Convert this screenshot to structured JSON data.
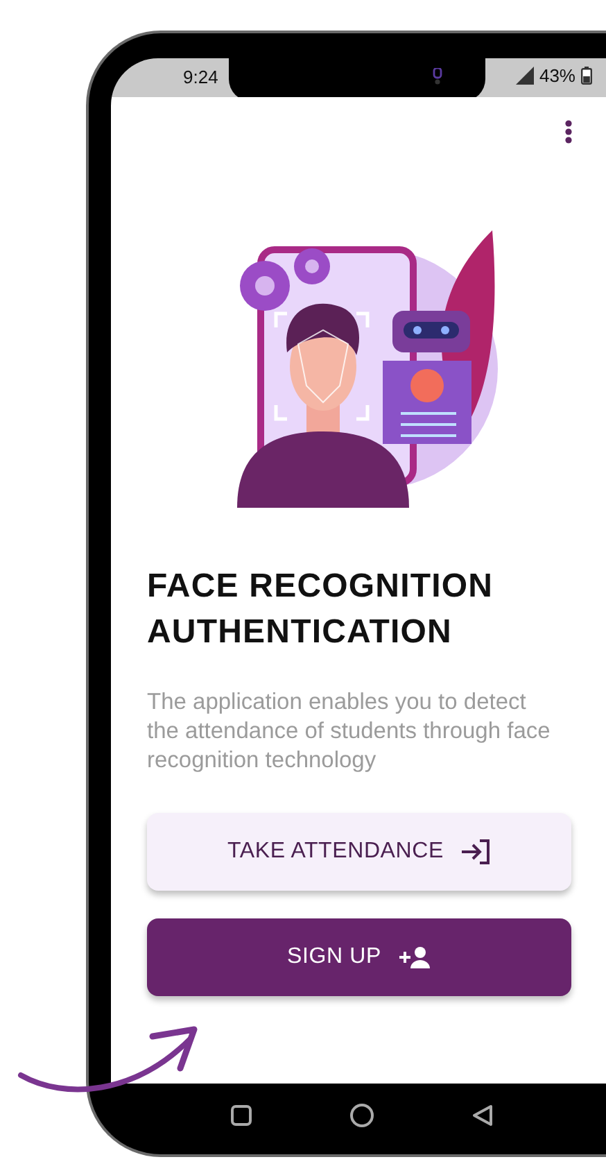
{
  "status_bar": {
    "time": "9:24",
    "battery": "43%"
  },
  "title": "FACE RECOGNITION AUTHENTICATION",
  "description": "The application enables you to detect the attendance of students through face recognition technology",
  "buttons": [
    {
      "label": "TAKE ATTENDANCE",
      "kind": "secondary"
    },
    {
      "label": "SIGN UP",
      "kind": "primary"
    }
  ]
}
